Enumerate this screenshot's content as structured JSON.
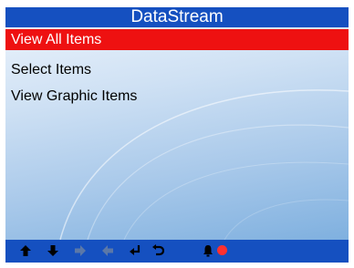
{
  "title": "DataStream",
  "menu": {
    "items": [
      {
        "label": "View All Items",
        "selected": true
      },
      {
        "label": "Select  Items",
        "selected": false
      },
      {
        "label": "View Graphic Items",
        "selected": false
      }
    ]
  },
  "toolbar": {
    "icons": [
      "arrow-up-icon",
      "arrow-down-icon",
      "arrow-right-icon",
      "arrow-left-icon",
      "enter-icon",
      "back-icon",
      "bell-icon",
      "record-icon"
    ]
  },
  "colors": {
    "titlebar": "#1550c0",
    "selected": "#ee1111",
    "record": "#ff3030"
  }
}
